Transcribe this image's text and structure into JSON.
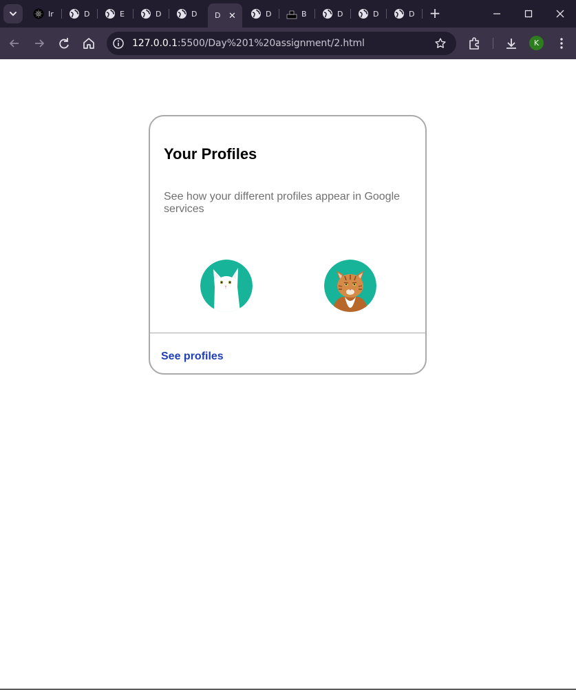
{
  "browser": {
    "tabs": [
      {
        "title": "Ir",
        "favicon": "app-icon",
        "active": false
      },
      {
        "title": "D",
        "favicon": "globe-icon",
        "active": false
      },
      {
        "title": "E",
        "favicon": "globe-icon",
        "active": false
      },
      {
        "title": "D",
        "favicon": "globe-icon",
        "active": false
      },
      {
        "title": "D",
        "favicon": "globe-icon",
        "active": false
      },
      {
        "title": "D",
        "favicon": "none",
        "active": true
      },
      {
        "title": "D",
        "favicon": "globe-icon",
        "active": false
      },
      {
        "title": "B",
        "favicon": "b-icon",
        "active": false
      },
      {
        "title": "D",
        "favicon": "globe-icon",
        "active": false
      },
      {
        "title": "D",
        "favicon": "globe-icon",
        "active": false
      },
      {
        "title": "D",
        "favicon": "globe-icon",
        "active": false
      }
    ],
    "address_host": "127.0.0.1",
    "address_rest": ":5500/Day%201%20assignment/2.html",
    "profile_initial": "K",
    "colors": {
      "tabstrip": "#221d2e",
      "toolbar": "#3b3448",
      "omnibox": "#221d2e",
      "avatar": "#2e7d1f"
    }
  },
  "card": {
    "title": "Your Profiles",
    "description": "See how your different profiles appear in Google services",
    "profiles": [
      {
        "name": "white-cat-avatar",
        "bg": "#17b49a"
      },
      {
        "name": "orange-tabby-cat-avatar",
        "bg": "#17b49a"
      }
    ],
    "link_label": "See profiles",
    "colors": {
      "border": "#a9a9a9",
      "link": "#1e3fb8",
      "description": "#707070"
    }
  }
}
